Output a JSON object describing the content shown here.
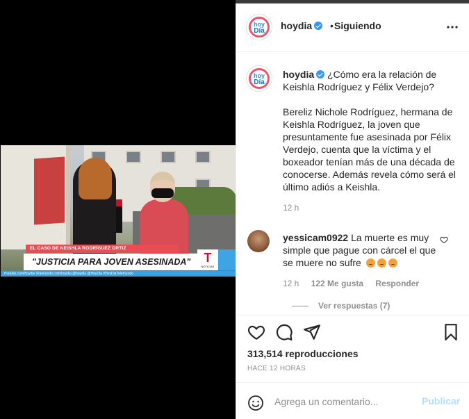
{
  "post": {
    "username": "hoydia",
    "follow_separator": "•",
    "follow_status": "Siguiendo",
    "avatar_top": "hoy",
    "avatar_bottom": "Día",
    "caption_question": "¿Cómo era la relación de Keishla Rodríguez y Félix Verdejo?",
    "caption_body": "Bereliz Nichole Rodríguez, hermana de Keishla Rodríguez, la joven que presuntamente fue asesinada por Félix Verdejo, cuenta que la víctima y el boxeador tenían más de una década de conocerse. Además revela cómo será el último adiós a Keishla.",
    "caption_time": "12 h",
    "views": "313,514 reproducciones",
    "time_ago": "HACE 12 HORAS"
  },
  "video": {
    "lower_third_top": "EL CASO DE KEISHLA RODRÍGUEZ ORTIZ",
    "lower_third_main": "\"JUSTICIA PARA JOVEN ASESINADA\"",
    "network_logo": "T",
    "network_sub": "NOTICIAS",
    "ticker": "Youtube.com/hoydia   Telemundo.com/hoydia   @hoydia   @HoyDia   #HoyDiaTelemundo"
  },
  "comment": {
    "username": "yessicam0922",
    "text": "La muerte es muy simple que pague con cárcel el que se muere no sufre",
    "time": "12 h",
    "likes": "122 Me gusta",
    "reply": "Responder",
    "view_replies": "Ver respuestas (7)"
  },
  "comment_bar": {
    "placeholder": "Agrega un comentario...",
    "post_label": "Publicar"
  },
  "icons": {
    "like": "heart-icon",
    "comment": "comment-icon",
    "share": "share-icon",
    "save": "bookmark-icon",
    "more": "more-options-icon",
    "emoji": "emoji-icon"
  },
  "colors": {
    "verified": "#3897f0",
    "post_button_disabled": "#b2dffc",
    "secondary_text": "#8e8e8e"
  }
}
